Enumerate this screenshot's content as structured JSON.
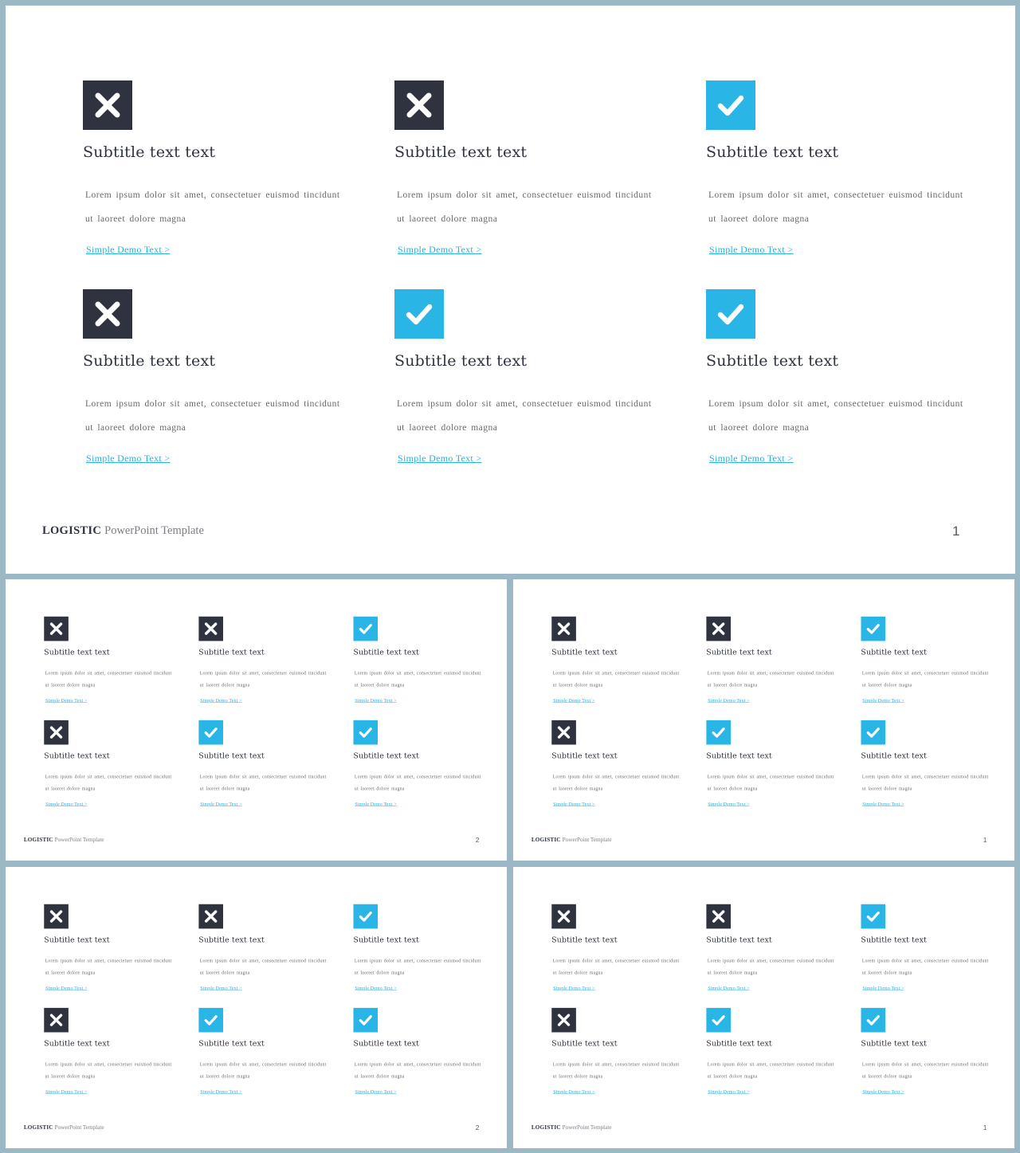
{
  "colors": {
    "dark": "#2e333f",
    "accent": "#29b6e6",
    "background": "#9cb8c6"
  },
  "slides": [
    {
      "name": "slide-main",
      "page_number": "1",
      "footer": {
        "brand": "LOGISTIC",
        "subtitle": "PowerPoint Template"
      },
      "items": [
        {
          "icon": "x",
          "subtitle": "Subtitle text text",
          "line1": "Lorem ipsum dolor sit amet, consectetuer euismod tincidunt",
          "line2": "ut laoreet dolore magna",
          "link": "Simple Demo Text >"
        },
        {
          "icon": "x",
          "subtitle": "Subtitle text text",
          "line1": "Lorem ipsum dolor sit amet, consectetuer euismod tincidunt",
          "line2": "ut laoreet dolore magna",
          "link": "Simple Demo Text >"
        },
        {
          "icon": "check",
          "subtitle": "Subtitle text text",
          "line1": "Lorem ipsum dolor sit amet, consectetuer euismod tincidunt",
          "line2": "ut laoreet dolore magna",
          "link": "Simple Demo Text >"
        },
        {
          "icon": "x",
          "subtitle": "Subtitle text text",
          "line1": "Lorem ipsum dolor sit amet, consectetuer euismod tincidunt",
          "line2": "ut laoreet dolore magna",
          "link": "Simple Demo Text >"
        },
        {
          "icon": "check",
          "subtitle": "Subtitle text text",
          "line1": "Lorem ipsum dolor sit amet, consectetuer euismod tincidunt",
          "line2": "ut laoreet dolore magna",
          "link": "Simple Demo Text >"
        },
        {
          "icon": "check",
          "subtitle": "Subtitle text text",
          "line1": "Lorem ipsum dolor sit amet, consectetuer euismod tincidunt",
          "line2": "ut laoreet dolore magna",
          "link": "Simple Demo Text >"
        }
      ]
    },
    {
      "name": "slide-thumb-top-left",
      "page_number": "2",
      "footer": {
        "brand": "LOGISTIC",
        "subtitle": "PowerPoint Template"
      },
      "items": [
        {
          "icon": "x",
          "subtitle": "Subtitle text text",
          "line1": "Lorem ipsum dolor sit amet, consectetuer euismod tincidunt",
          "line2": "ut laoreet dolore magna",
          "link": "Simple Demo Text >"
        },
        {
          "icon": "x",
          "subtitle": "Subtitle text text",
          "line1": "Lorem ipsum dolor sit amet, consectetuer euismod tincidunt",
          "line2": "ut laoreet dolore magna",
          "link": "Simple Demo Text >"
        },
        {
          "icon": "check",
          "subtitle": "Subtitle text text",
          "line1": "Lorem ipsum dolor sit amet, consectetuer euismod tincidunt",
          "line2": "ut laoreet dolore magna",
          "link": "Simple Demo Text >"
        },
        {
          "icon": "x",
          "subtitle": "Subtitle text text",
          "line1": "Lorem ipsum dolor sit amet, consectetuer euismod tincidunt",
          "line2": "ut laoreet dolore magna",
          "link": "Simple Demo Text >"
        },
        {
          "icon": "check",
          "subtitle": "Subtitle text text",
          "line1": "Lorem ipsum dolor sit amet, consectetuer euismod tincidunt",
          "line2": "ut laoreet dolore magna",
          "link": "Simple Demo Text >"
        },
        {
          "icon": "check",
          "subtitle": "Subtitle text text",
          "line1": "Lorem ipsum dolor sit amet, consectetuer euismod tincidunt",
          "line2": "ut laoreet dolore magna",
          "link": "Simple Demo Text >"
        }
      ]
    },
    {
      "name": "slide-thumb-top-right",
      "page_number": "1",
      "footer": {
        "brand": "LOGISTIC",
        "subtitle": "PowerPoint Template"
      },
      "items": [
        {
          "icon": "x",
          "subtitle": "Subtitle text text",
          "line1": "Lorem ipsum dolor sit amet, consectetuer euismod tincidunt",
          "line2": "ut laoreet dolore magna",
          "link": "Simple Demo Text >"
        },
        {
          "icon": "x",
          "subtitle": "Subtitle text text",
          "line1": "Lorem ipsum dolor sit amet, consectetuer euismod tincidunt",
          "line2": "ut laoreet dolore magna",
          "link": "Simple Demo Text >"
        },
        {
          "icon": "check",
          "subtitle": "Subtitle text text",
          "line1": "Lorem ipsum dolor sit amet, consectetuer euismod tincidunt",
          "line2": "ut laoreet dolore magna",
          "link": "Simple Demo Text >"
        },
        {
          "icon": "x",
          "subtitle": "Subtitle text text",
          "line1": "Lorem ipsum dolor sit amet, consectetuer euismod tincidunt",
          "line2": "ut laoreet dolore magna",
          "link": "Simple Demo Text >"
        },
        {
          "icon": "check",
          "subtitle": "Subtitle text text",
          "line1": "Lorem ipsum dolor sit amet, consectetuer euismod tincidunt",
          "line2": "ut laoreet dolore magna",
          "link": "Simple Demo Text >"
        },
        {
          "icon": "check",
          "subtitle": "Subtitle text text",
          "line1": "Lorem ipsum dolor sit amet, consectetuer euismod tincidunt",
          "line2": "ut laoreet dolore magna",
          "link": "Simple Demo Text >"
        }
      ]
    },
    {
      "name": "slide-thumb-bottom-left",
      "page_number": "2",
      "footer": {
        "brand": "LOGISTIC",
        "subtitle": "PowerPoint Template"
      },
      "items": [
        {
          "icon": "x",
          "subtitle": "Subtitle text text",
          "line1": "Lorem ipsum dolor sit amet, consectetuer euismod tincidunt",
          "line2": "ut laoreet dolore magna",
          "link": "Simple Demo Text >"
        },
        {
          "icon": "x",
          "subtitle": "Subtitle text text",
          "line1": "Lorem ipsum dolor sit amet, consectetuer euismod tincidunt",
          "line2": "ut laoreet dolore magna",
          "link": "Simple Demo Text >"
        },
        {
          "icon": "check",
          "subtitle": "Subtitle text text",
          "line1": "Lorem ipsum dolor sit amet, consectetuer euismod tincidunt",
          "line2": "ut laoreet dolore magna",
          "link": "Simple Demo Text >"
        },
        {
          "icon": "x",
          "subtitle": "Subtitle text text",
          "line1": "Lorem ipsum dolor sit amet, consectetuer euismod tincidunt",
          "line2": "ut laoreet dolore magna",
          "link": "Simple Demo Text >"
        },
        {
          "icon": "check",
          "subtitle": "Subtitle text text",
          "line1": "Lorem ipsum dolor sit amet, consectetuer euismod tincidunt",
          "line2": "ut laoreet dolore magna",
          "link": "Simple Demo Text >"
        },
        {
          "icon": "check",
          "subtitle": "Subtitle text text",
          "line1": "Lorem ipsum dolor sit amet, consectetuer euismod tincidunt",
          "line2": "ut laoreet dolore magna",
          "link": "Simple Demo Text >"
        }
      ]
    },
    {
      "name": "slide-thumb-bottom-right",
      "page_number": "1",
      "footer": {
        "brand": "LOGISTIC",
        "subtitle": "PowerPoint Template"
      },
      "items": [
        {
          "icon": "x",
          "subtitle": "Subtitle text text",
          "line1": "Lorem ipsum dolor sit amet, consectetuer euismod tincidunt",
          "line2": "ut laoreet dolore magna",
          "link": "Simple Demo Text >"
        },
        {
          "icon": "x",
          "subtitle": "Subtitle text text",
          "line1": "Lorem ipsum dolor sit amet, consectetuer euismod tincidunt",
          "line2": "ut laoreet dolore magna",
          "link": "Simple Demo Text >"
        },
        {
          "icon": "check",
          "subtitle": "Subtitle text text",
          "line1": "Lorem ipsum dolor sit amet, consectetuer euismod tincidunt",
          "line2": "ut laoreet dolore magna",
          "link": "Simple Demo Text >"
        },
        {
          "icon": "x",
          "subtitle": "Subtitle text text",
          "line1": "Lorem ipsum dolor sit amet, consectetuer euismod tincidunt",
          "line2": "ut laoreet dolore magna",
          "link": "Simple Demo Text >"
        },
        {
          "icon": "check",
          "subtitle": "Subtitle text text",
          "line1": "Lorem ipsum dolor sit amet, consectetuer euismod tincidunt",
          "line2": "ut laoreet dolore magna",
          "link": "Simple Demo Text >"
        },
        {
          "icon": "check",
          "subtitle": "Subtitle text text",
          "line1": "Lorem ipsum dolor sit amet, consectetuer euismod tincidunt",
          "line2": "ut laoreet dolore magna",
          "link": "Simple Demo Text >"
        }
      ]
    }
  ]
}
